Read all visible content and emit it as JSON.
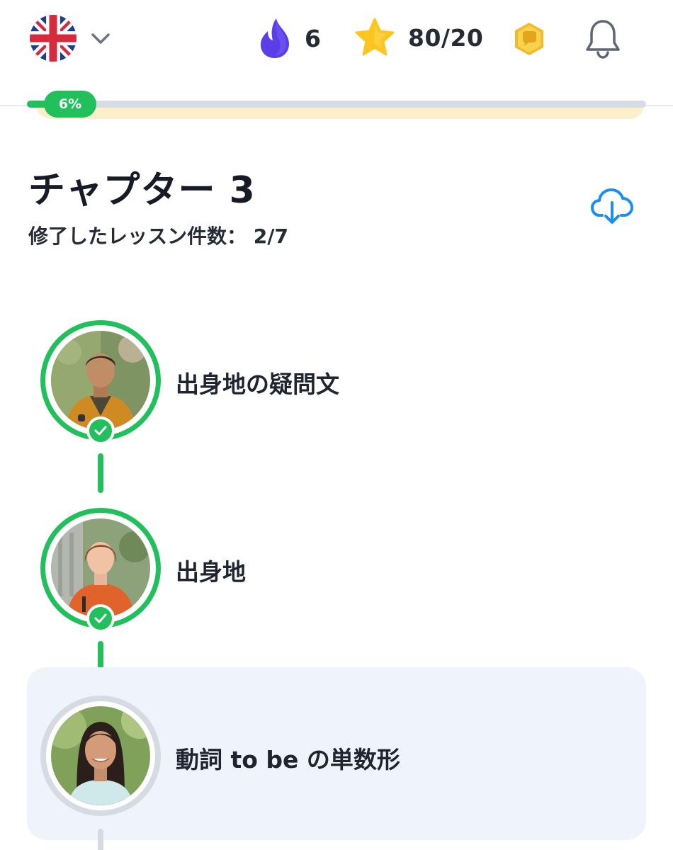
{
  "header": {
    "language_flag": "uk-flag-icon",
    "streak_count": "6",
    "stars_text": "80/20",
    "colors": {
      "streak": "#5b3ee8",
      "star": "#fdc51f",
      "coin": "#f7c948"
    }
  },
  "progress": {
    "percent_label": "6%",
    "value": 0.06
  },
  "chapter": {
    "title": "チャプター 3",
    "lessons_completed_text": "修了したレッスン件数： 2/7"
  },
  "lessons": [
    {
      "title": "出身地の疑問文",
      "status": "completed"
    },
    {
      "title": "出身地",
      "status": "completed"
    },
    {
      "title": "動詞 to be の単数形",
      "status": "current"
    }
  ],
  "colors": {
    "accent_green": "#21c05c",
    "card_bg": "#eff4fc",
    "download_blue": "#1b8ef0"
  }
}
